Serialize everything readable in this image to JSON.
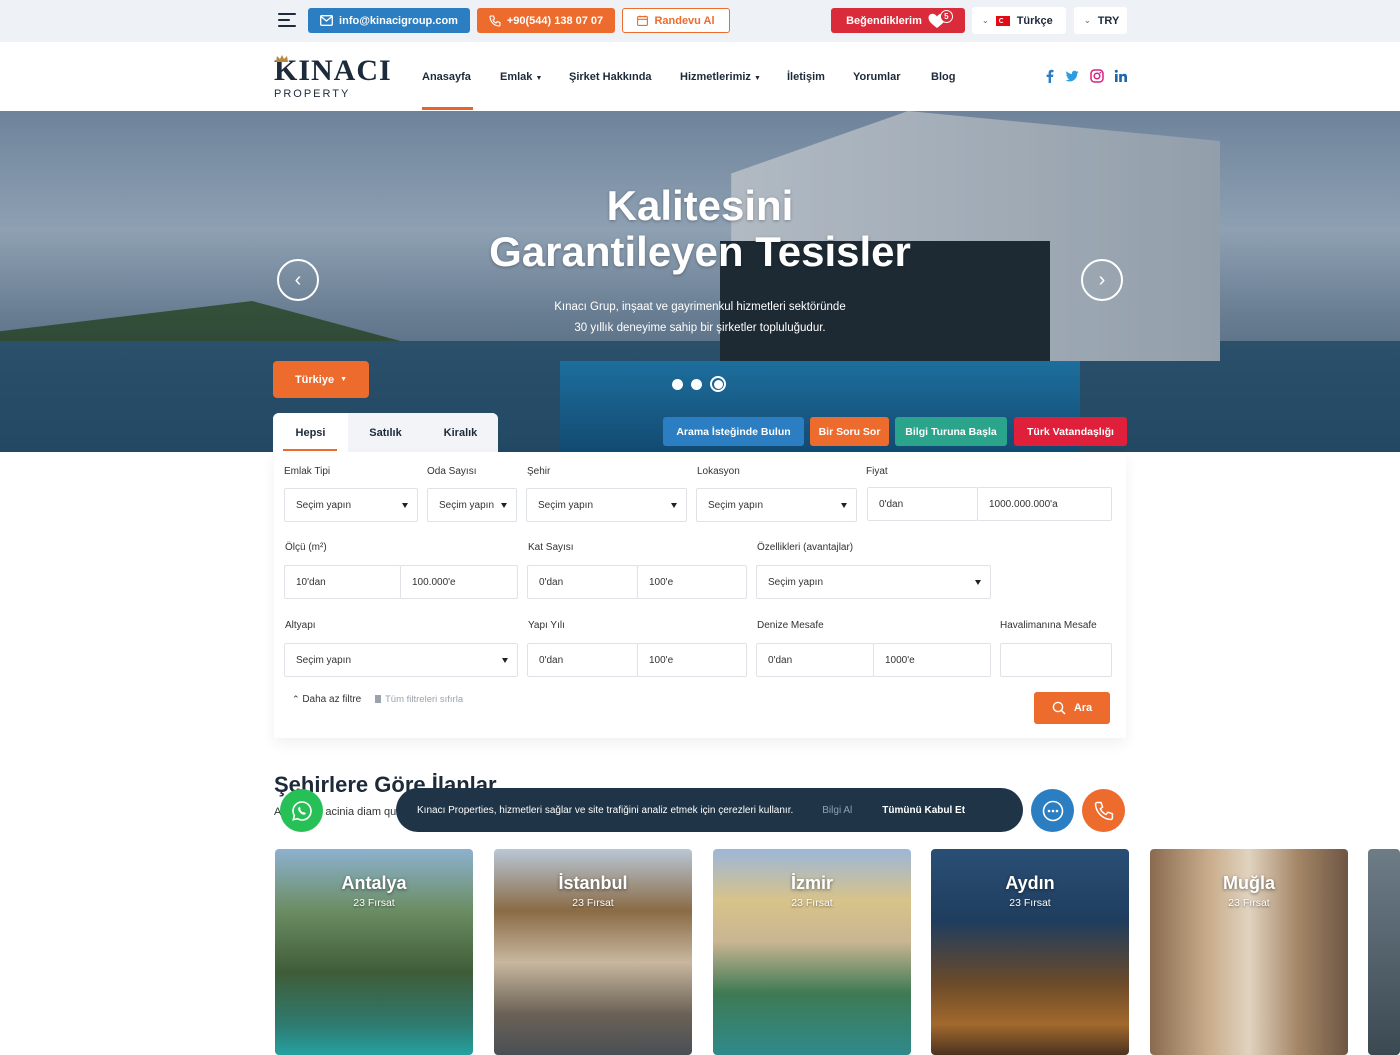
{
  "topbar": {
    "email": "info@kinacigroup.com",
    "phone": "+90(544) 138 07 07",
    "appointment": "Randevu Al",
    "favorites": "Beğendiklerim",
    "favorites_count": "5",
    "language": "Türkçe",
    "currency": "TRY"
  },
  "logo": {
    "name": "KINACI",
    "sub": "PROPERTY"
  },
  "nav": {
    "items": [
      "Anasayfa",
      "Emlak",
      "Şirket Hakkında",
      "Hizmetlerimiz",
      "İletişim",
      "Yorumlar",
      "Blog"
    ],
    "active": "Anasayfa"
  },
  "social": [
    "facebook-icon",
    "twitter-icon",
    "instagram-icon",
    "linkedin-icon"
  ],
  "hero": {
    "title_line1": "Kalitesini",
    "title_line2": "Garantileyen Tesisler",
    "desc_line1": "Kınacı Grup, inşaat ve gayrimenkul hizmetleri sektöründe",
    "desc_line2": "30 yıllık deneyime sahip bir şirketler topluluğudur.",
    "slides": 3,
    "active_slide": 3,
    "country": "Türkiye"
  },
  "search_tabs": [
    "Hepsi",
    "Satılık",
    "Kiralık"
  ],
  "action_buttons": [
    {
      "label": "Arama İsteğinde Bulun",
      "color": "#2b7ec1"
    },
    {
      "label": "Bir Soru Sor",
      "color": "#ec6b2d"
    },
    {
      "label": "Bilgi Turuna Başla",
      "color": "#2aa58b"
    },
    {
      "label": "Türk Vatandaşlığı",
      "color": "#e0203a"
    }
  ],
  "form": {
    "emlak_tipi": {
      "label": "Emlak Tipi",
      "value": "Seçim yapın"
    },
    "oda_sayisi": {
      "label": "Oda Sayısı",
      "value": "Seçim yapın"
    },
    "sehir": {
      "label": "Şehir",
      "value": "Seçim yapın"
    },
    "lokasyon": {
      "label": "Lokasyon",
      "value": "Seçim yapın"
    },
    "fiyat": {
      "label": "Fiyat",
      "min": "0'dan",
      "max": "1000.000.000'a"
    },
    "olcu": {
      "label": "Ölçü (m²)",
      "min": "10'dan",
      "max": "100.000'e"
    },
    "kat": {
      "label": "Kat Sayısı",
      "min": "0'dan",
      "max": "100'e"
    },
    "ozellikler": {
      "label": "Özellikleri (avantajlar)",
      "value": "Seçim yapın"
    },
    "altyapi": {
      "label": "Altyapı",
      "value": "Seçim yapın"
    },
    "yapi_yili": {
      "label": "Yapı Yılı",
      "min": "0'dan",
      "max": "100'e"
    },
    "deniz": {
      "label": "Denize Mesafe",
      "min": "0'dan",
      "max": "1000'e"
    },
    "havalimani": {
      "label": "Havalimanına Mesafe",
      "value": ""
    },
    "less_filter": "Daha az filtre",
    "reset": "Tüm filtreleri sıfırla",
    "search": "Ara"
  },
  "cities_section": {
    "title": "Şehirlere Göre İlanlar",
    "subtitle_left": "A",
    "subtitle_right": "acinia diam qu",
    "cards": [
      {
        "name": "Antalya",
        "count": "23 Fırsat"
      },
      {
        "name": "İstanbul",
        "count": "23 Fırsat"
      },
      {
        "name": "İzmir",
        "count": "23 Fırsat"
      },
      {
        "name": "Aydın",
        "count": "23 Fırsat"
      },
      {
        "name": "Muğla",
        "count": "23 Fırsat"
      }
    ]
  },
  "cookie": {
    "text": "Kınacı Properties, hizmetleri sağlar ve site trafiğini analiz etmek için çerezleri kullanır.",
    "info": "Bilgi Al",
    "accept": "Tümünü Kabul Et"
  },
  "colors": {
    "orange": "#ec6b2d",
    "blue": "#2b7ec1",
    "red": "#d92b3a",
    "navy": "#1d2a3a"
  }
}
